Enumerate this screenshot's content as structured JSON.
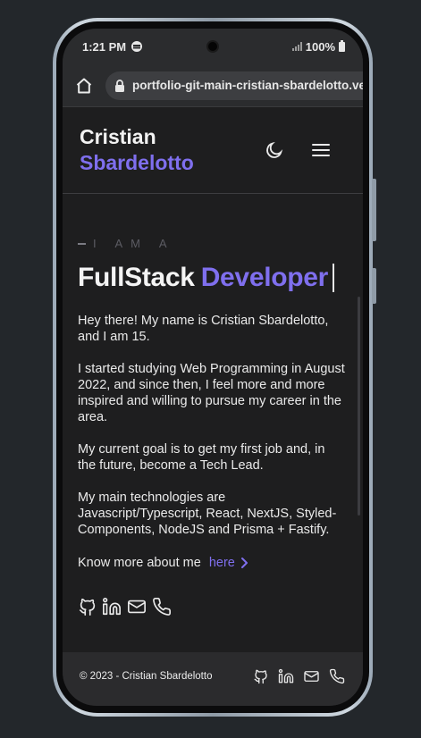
{
  "status": {
    "time": "1:21 PM",
    "battery": "100%"
  },
  "browser": {
    "url": "portfolio-git-main-cristian-sbardelotto.vercel.app"
  },
  "header": {
    "first_name": "Cristian",
    "last_name": "Sbardelotto"
  },
  "hero": {
    "eyebrow": "I AM A",
    "title_part1": "FullStack",
    "title_part2": "Developer"
  },
  "about": {
    "p1": "Hey there! My name is Cristian Sbardelotto, and I am 15.",
    "p2": "I started studying Web Programming in August 2022, and since then, I feel more and more inspired and willing to pursue my career in the area.",
    "p3": "My current goal is to get my first job and, in the future, become a Tech Lead.",
    "p4": "My main technologies are Javascript/Typescript, React, NextJS, Styled-Components, NodeJS and Prisma + Fastify.",
    "more_text": "Know more about me",
    "more_link": "here"
  },
  "footer": {
    "copyright": "© 2023 - Cristian Sbardelotto"
  },
  "colors": {
    "accent": "#7f6fee",
    "background": "#1e1e1f",
    "bar": "#2b2c2e"
  },
  "icons": [
    "home-icon",
    "lock-icon",
    "moon-icon",
    "menu-icon",
    "github-icon",
    "linkedin-icon",
    "mail-icon",
    "phone-icon",
    "chevron-right-icon"
  ]
}
